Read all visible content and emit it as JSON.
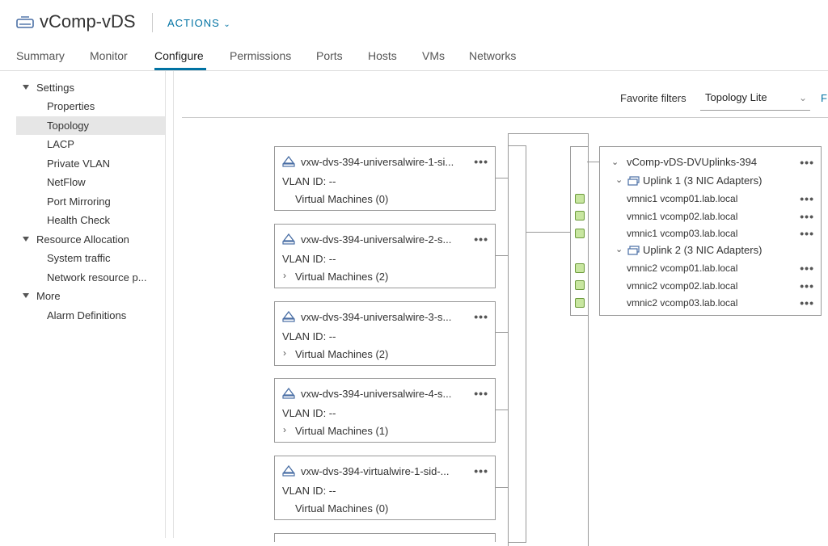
{
  "header": {
    "title": "vComp-vDS",
    "actions_label": "ACTIONS"
  },
  "tabs": [
    {
      "label": "Summary"
    },
    {
      "label": "Monitor"
    },
    {
      "label": "Configure"
    },
    {
      "label": "Permissions"
    },
    {
      "label": "Ports"
    },
    {
      "label": "Hosts"
    },
    {
      "label": "VMs"
    },
    {
      "label": "Networks"
    }
  ],
  "tree": {
    "settings": "Settings",
    "properties": "Properties",
    "topology": "Topology",
    "lacp": "LACP",
    "private_vlan": "Private VLAN",
    "netflow": "NetFlow",
    "port_mirroring": "Port Mirroring",
    "health_check": "Health Check",
    "resource_allocation": "Resource Allocation",
    "system_traffic": "System traffic",
    "network_resource": "Network resource p...",
    "more": "More",
    "alarm_definitions": "Alarm Definitions"
  },
  "filters": {
    "favorite_label": "Favorite filters",
    "favorite_value": "Topology Lite",
    "f_label": "F"
  },
  "port_groups": [
    {
      "name": "vxw-dvs-394-universalwire-1-si...",
      "vlan": "VLAN ID: --",
      "vms": "Virtual Machines (0)",
      "expandable": false
    },
    {
      "name": "vxw-dvs-394-universalwire-2-s...",
      "vlan": "VLAN ID: --",
      "vms": "Virtual Machines (2)",
      "expandable": true
    },
    {
      "name": "vxw-dvs-394-universalwire-3-s...",
      "vlan": "VLAN ID: --",
      "vms": "Virtual Machines (2)",
      "expandable": true
    },
    {
      "name": "vxw-dvs-394-universalwire-4-s...",
      "vlan": "VLAN ID: --",
      "vms": "Virtual Machines (1)",
      "expandable": true
    },
    {
      "name": "vxw-dvs-394-virtualwire-1-sid-...",
      "vlan": "VLAN ID: --",
      "vms": "Virtual Machines (0)",
      "expandable": false
    }
  ],
  "uplinks": {
    "name": "vComp-vDS-DVUplinks-394",
    "uplink1": "Uplink 1 (3 NIC Adapters)",
    "uplink1_nics": [
      "vmnic1 vcomp01.lab.local",
      "vmnic1 vcomp02.lab.local",
      "vmnic1 vcomp03.lab.local"
    ],
    "uplink2": "Uplink 2 (3 NIC Adapters)",
    "uplink2_nics": [
      "vmnic2 vcomp01.lab.local",
      "vmnic2 vcomp02.lab.local",
      "vmnic2 vcomp03.lab.local"
    ]
  },
  "colors": {
    "accent": "#0072a3",
    "port_fill": "#c8e6a0"
  }
}
